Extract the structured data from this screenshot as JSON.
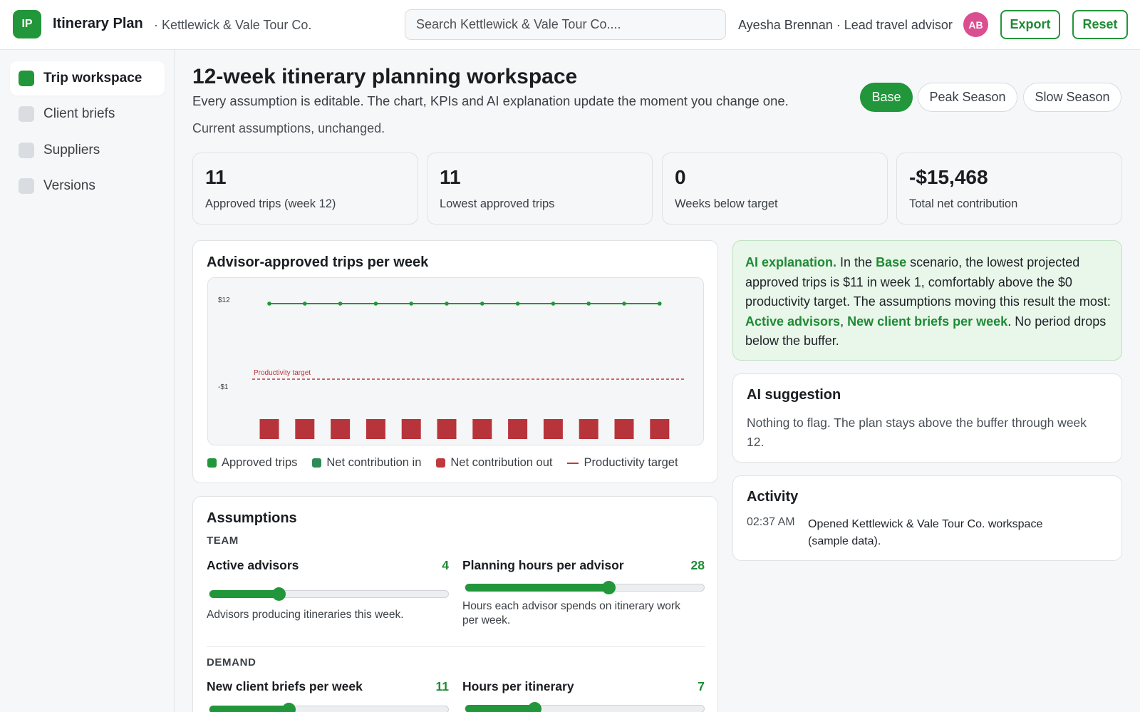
{
  "header": {
    "logo_text": "IP",
    "app_title": "Itinerary Plan",
    "company": "· Kettlewick & Vale Tour Co.",
    "search_placeholder": "Search Kettlewick & Vale Tour Co....",
    "user": "Ayesha Brennan · Lead travel advisor",
    "avatar_initials": "AB",
    "export_label": "Export",
    "reset_label": "Reset"
  },
  "sidebar": {
    "items": [
      {
        "label": "Trip workspace",
        "active": true
      },
      {
        "label": "Client briefs",
        "active": false
      },
      {
        "label": "Suppliers",
        "active": false
      },
      {
        "label": "Versions",
        "active": false
      }
    ]
  },
  "main": {
    "title": "12-week itinerary planning workspace",
    "subtitle": "Every assumption is editable. The chart, KPIs and AI explanation update the moment you change one.",
    "status": "Current assumptions, unchanged.",
    "scenarios": [
      {
        "label": "Base",
        "active": true
      },
      {
        "label": "Peak Season",
        "active": false
      },
      {
        "label": "Slow Season",
        "active": false
      }
    ]
  },
  "kpis": [
    {
      "value": "11",
      "label": "Approved trips (week 12)"
    },
    {
      "value": "11",
      "label": "Lowest approved trips"
    },
    {
      "value": "0",
      "label": "Weeks below target"
    },
    {
      "value": "-$15,468",
      "label": "Total net contribution"
    }
  ],
  "chart_card": {
    "title": "Advisor-approved trips per week"
  },
  "chart_data": {
    "type": "bar",
    "title": "Advisor-approved trips per week",
    "y_tick_labels": [
      "$12",
      "-$1"
    ],
    "target_label": "Productivity target",
    "target_value": 0,
    "series": [
      {
        "name": "Approved trips",
        "type": "line",
        "color": "#22963a",
        "values": [
          11,
          11,
          11,
          11,
          11,
          11,
          11,
          11,
          11,
          11,
          11,
          11
        ]
      },
      {
        "name": "Net contribution out",
        "type": "bar",
        "color": "#b8343b",
        "values": [
          -1289,
          -1289,
          -1289,
          -1289,
          -1289,
          -1289,
          -1289,
          -1289,
          -1289,
          -1289,
          -1289,
          -1289
        ]
      }
    ],
    "legend": [
      {
        "name": "Approved trips",
        "color": "#22963a",
        "shape": "square"
      },
      {
        "name": "Net contribution in",
        "color": "#2e8b57",
        "shape": "square"
      },
      {
        "name": "Net contribution out",
        "color": "#c0393f",
        "shape": "square"
      },
      {
        "name": "Productivity target",
        "color": "#c0393f",
        "shape": "line"
      }
    ],
    "legend_position": "bottom",
    "grid": false
  },
  "ai": {
    "prefix": "AI explanation.",
    "t1": " In the ",
    "scenario": "Base",
    "t2": " scenario, the lowest projected approved trips is $11 in week 1, comfortably above the $0 productivity target. The assumptions moving this result the most: ",
    "driver1": "Active advisors",
    "sep": ", ",
    "driver2": "New client briefs per week",
    "t3": ". No period drops below the buffer."
  },
  "suggestion": {
    "title": "AI suggestion",
    "text": "Nothing to flag. The plan stays above the buffer through week 12."
  },
  "activity": {
    "title": "Activity",
    "time": "02:37 AM",
    "message": "Opened Kettlewick & Vale Tour Co. workspace (sample data)."
  },
  "assumptions": {
    "title": "Assumptions",
    "team_label": "TEAM",
    "demand_label": "DEMAND",
    "active_advisors": {
      "name": "Active advisors",
      "value": "4",
      "fraction": 0.29,
      "desc": "Advisors producing itineraries this week."
    },
    "planning_hours": {
      "name": "Planning hours per advisor",
      "value": "28",
      "fraction": 0.6,
      "desc": "Hours each advisor spends on itinerary work per week."
    },
    "client_briefs": {
      "name": "New client briefs per week",
      "value": "11",
      "fraction": 0.33
    },
    "hours_itinerary": {
      "name": "Hours per itinerary",
      "value": "7",
      "fraction": 0.29
    }
  },
  "colors": {
    "accent": "#22963a",
    "negative": "#b8343b",
    "ai_background": "#e9f6ea"
  }
}
